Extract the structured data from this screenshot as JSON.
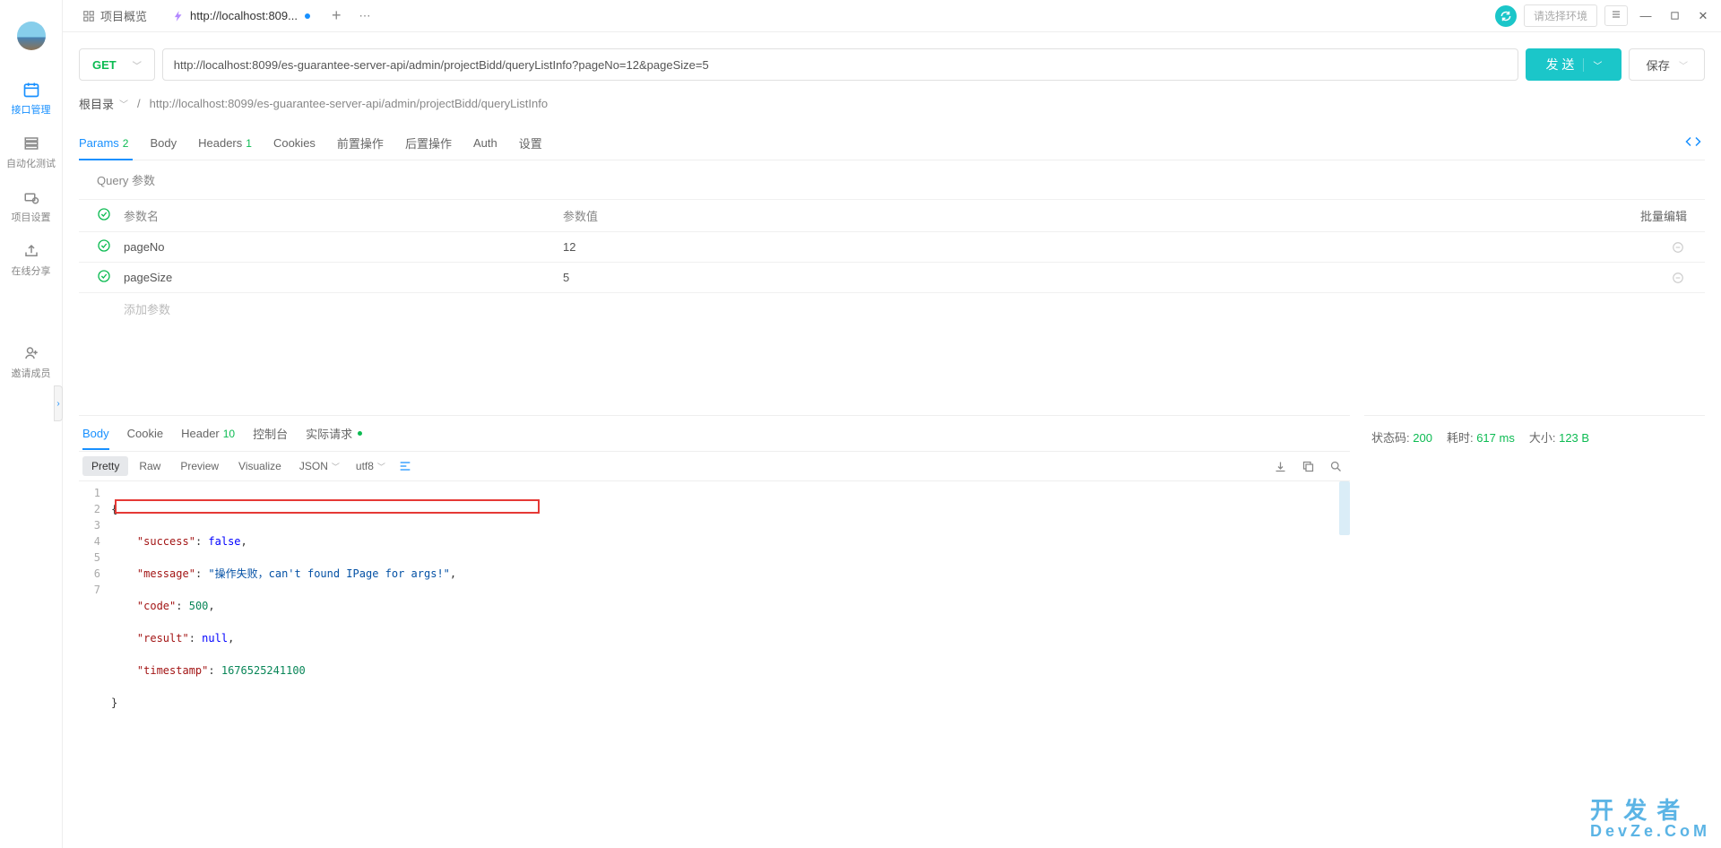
{
  "sidebar": {
    "items": [
      {
        "label": "接口管理",
        "icon": "calendar"
      },
      {
        "label": "自动化测试",
        "icon": "list"
      },
      {
        "label": "项目设置",
        "icon": "settings"
      },
      {
        "label": "在线分享",
        "icon": "share"
      }
    ],
    "bottom": {
      "label": "邀请成员",
      "icon": "user-add"
    }
  },
  "tabs": {
    "overview": "项目概览",
    "active": "http://localhost:809..."
  },
  "title_right": {
    "env_placeholder": "请选择环境"
  },
  "request": {
    "method": "GET",
    "url": "http://localhost:8099/es-guarantee-server-api/admin/projectBidd/queryListInfo?pageNo=12&pageSize=5",
    "send_label": "发 送",
    "save_label": "保存"
  },
  "breadcrumb": {
    "root": "根目录",
    "path": "http://localhost:8099/es-guarantee-server-api/admin/projectBidd/queryListInfo"
  },
  "req_tabs": {
    "params": "Params",
    "params_badge": "2",
    "body": "Body",
    "headers": "Headers",
    "headers_badge": "1",
    "cookies": "Cookies",
    "pre": "前置操作",
    "post": "后置操作",
    "auth": "Auth",
    "settings": "设置"
  },
  "query_section": {
    "title": "Query 参数",
    "header_name": "参数名",
    "header_value": "参数值",
    "batch_edit": "批量编辑",
    "add_param": "添加参数",
    "rows": [
      {
        "name": "pageNo",
        "value": "12"
      },
      {
        "name": "pageSize",
        "value": "5"
      }
    ]
  },
  "resp_tabs": {
    "body": "Body",
    "cookie": "Cookie",
    "header": "Header",
    "header_badge": "10",
    "console": "控制台",
    "actual": "实际请求"
  },
  "resp_toolbar": {
    "pretty": "Pretty",
    "raw": "Raw",
    "preview": "Preview",
    "visualize": "Visualize",
    "format": "JSON",
    "encoding": "utf8"
  },
  "response_body": {
    "lines": [
      "1",
      "2",
      "3",
      "4",
      "5",
      "6",
      "7"
    ],
    "l1": "{",
    "l2_k": "\"success\"",
    "l2_v": "false",
    "l2_c": ",",
    "l3_k": "\"message\"",
    "l3_v": "\"操作失败，can't found IPage for args!\"",
    "l3_c": ",",
    "l4_k": "\"code\"",
    "l4_v": "500",
    "l4_c": ",",
    "l5_k": "\"result\"",
    "l5_v": "null",
    "l5_c": ",",
    "l6_k": "\"timestamp\"",
    "l6_v": "1676525241100",
    "l7": "}"
  },
  "status": {
    "code_label": "状态码:",
    "code": "200",
    "time_label": "耗时:",
    "time": "617 ms",
    "size_label": "大小:",
    "size": "123 B"
  },
  "watermark": {
    "main": "开 发 者",
    "sub": "DevZe.CoM"
  }
}
